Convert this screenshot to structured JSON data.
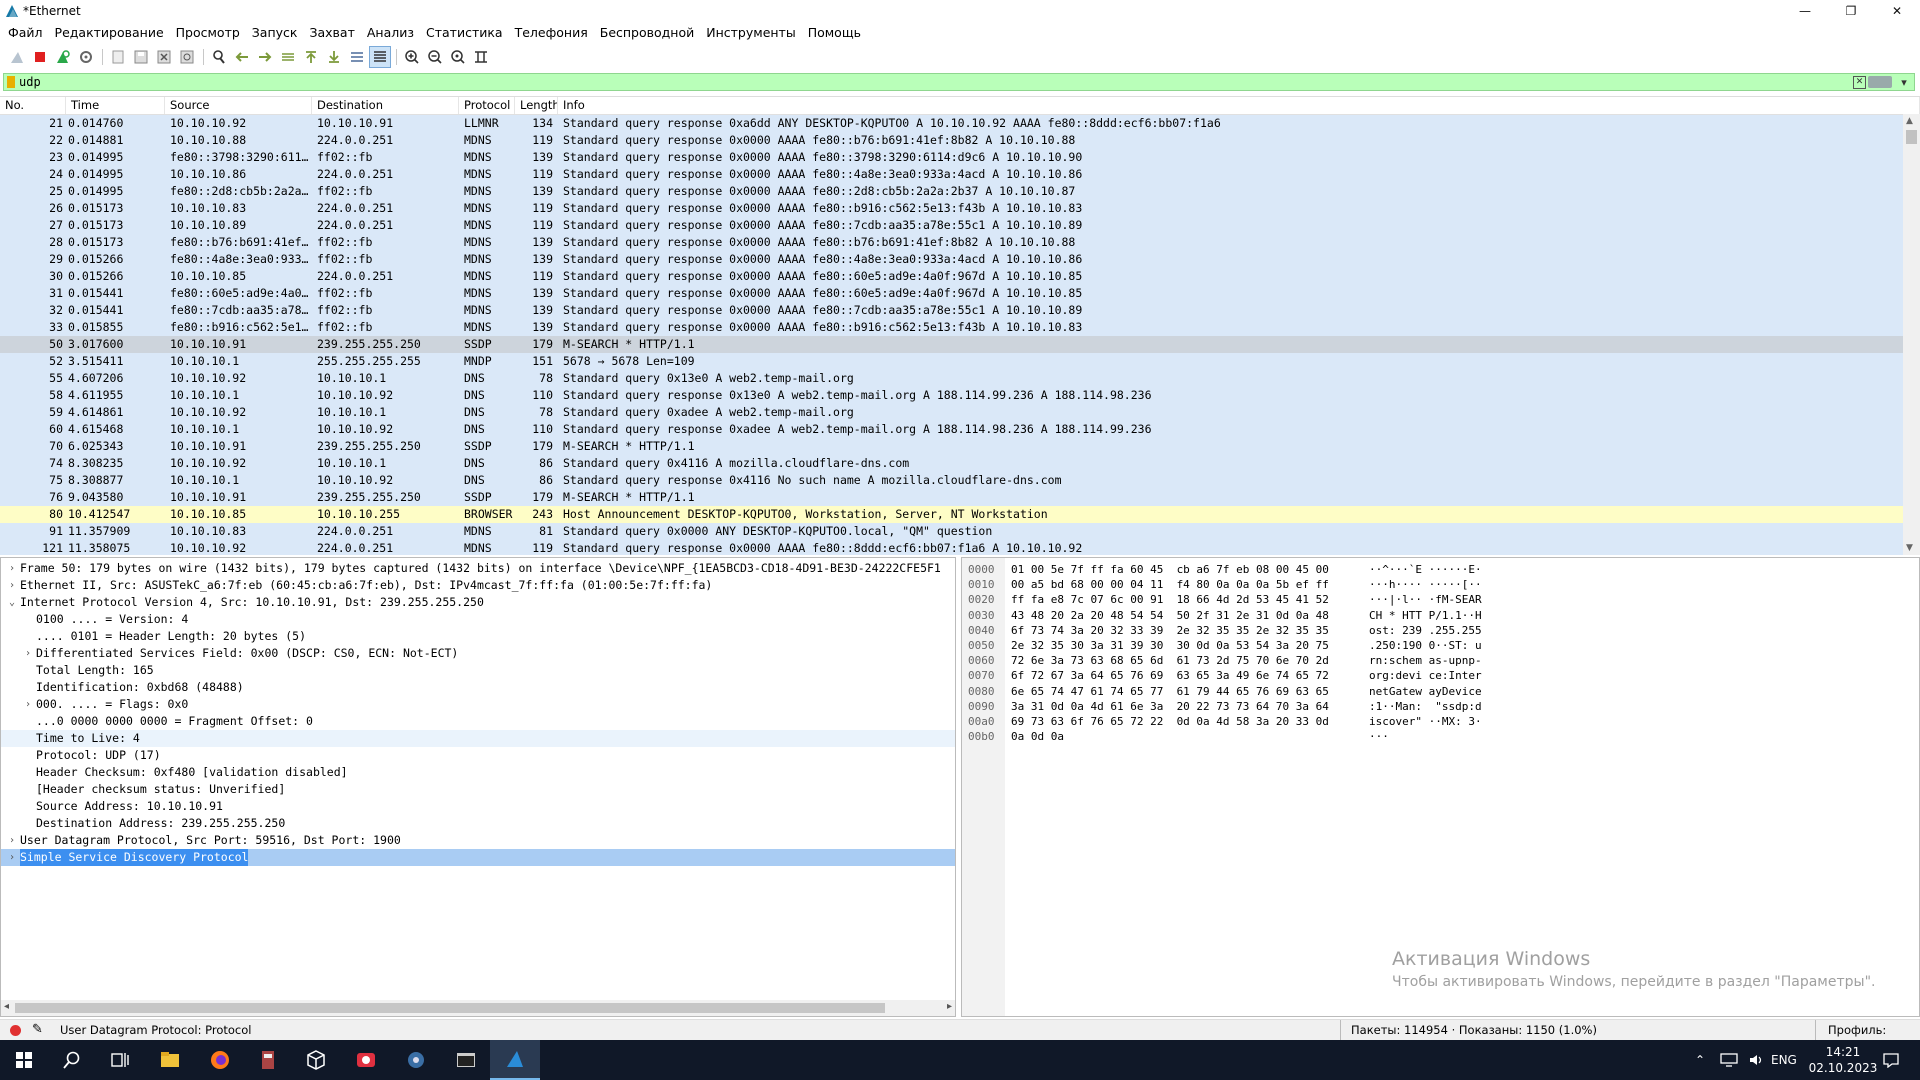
{
  "window": {
    "title": "*Ethernet",
    "controls": [
      "—",
      "❐",
      "✕"
    ]
  },
  "menu": [
    "Файл",
    "Редактирование",
    "Просмотр",
    "Запуск",
    "Захват",
    "Анализ",
    "Статистика",
    "Телефония",
    "Беспроводной",
    "Инструменты",
    "Помощь"
  ],
  "toolbar_icons": [
    "shark-fin-start-icon",
    "stop-icon",
    "restart-icon",
    "options-gear-icon",
    "open-file-icon",
    "save-icon",
    "close-file-icon",
    "reload-icon",
    "find-icon",
    "go-back-icon",
    "go-forward-icon",
    "go-to-packet-icon",
    "first-packet-icon",
    "last-packet-icon",
    "auto-scroll-icon",
    "colorize-icon",
    "zoom-in-icon",
    "zoom-out-icon",
    "normal-size-icon",
    "resize-columns-icon"
  ],
  "filter": {
    "value": "udp"
  },
  "packet_list": {
    "columns": [
      "No.",
      "Time",
      "Source",
      "Destination",
      "Protocol",
      "Length",
      "Info"
    ],
    "rows": [
      {
        "no": "21",
        "time": "0.014760",
        "src": "10.10.10.92",
        "dst": "10.10.10.91",
        "proto": "LLMNR",
        "len": "134",
        "info": "Standard query response 0xa6dd ANY DESKTOP-KQPUTO0 A 10.10.10.92 AAAA fe80::8ddd:ecf6:bb07:f1a6"
      },
      {
        "no": "22",
        "time": "0.014881",
        "src": "10.10.10.88",
        "dst": "224.0.0.251",
        "proto": "MDNS",
        "len": "119",
        "info": "Standard query response 0x0000 AAAA fe80::b76:b691:41ef:8b82 A 10.10.10.88"
      },
      {
        "no": "23",
        "time": "0.014995",
        "src": "fe80::3798:3290:611…",
        "dst": "ff02::fb",
        "proto": "MDNS",
        "len": "139",
        "info": "Standard query response 0x0000 AAAA fe80::3798:3290:6114:d9c6 A 10.10.10.90"
      },
      {
        "no": "24",
        "time": "0.014995",
        "src": "10.10.10.86",
        "dst": "224.0.0.251",
        "proto": "MDNS",
        "len": "119",
        "info": "Standard query response 0x0000 AAAA fe80::4a8e:3ea0:933a:4acd A 10.10.10.86"
      },
      {
        "no": "25",
        "time": "0.014995",
        "src": "fe80::2d8:cb5b:2a2a…",
        "dst": "ff02::fb",
        "proto": "MDNS",
        "len": "139",
        "info": "Standard query response 0x0000 AAAA fe80::2d8:cb5b:2a2a:2b37 A 10.10.10.87"
      },
      {
        "no": "26",
        "time": "0.015173",
        "src": "10.10.10.83",
        "dst": "224.0.0.251",
        "proto": "MDNS",
        "len": "119",
        "info": "Standard query response 0x0000 AAAA fe80::b916:c562:5e13:f43b A 10.10.10.83"
      },
      {
        "no": "27",
        "time": "0.015173",
        "src": "10.10.10.89",
        "dst": "224.0.0.251",
        "proto": "MDNS",
        "len": "119",
        "info": "Standard query response 0x0000 AAAA fe80::7cdb:aa35:a78e:55c1 A 10.10.10.89"
      },
      {
        "no": "28",
        "time": "0.015173",
        "src": "fe80::b76:b691:41ef…",
        "dst": "ff02::fb",
        "proto": "MDNS",
        "len": "139",
        "info": "Standard query response 0x0000 AAAA fe80::b76:b691:41ef:8b82 A 10.10.10.88"
      },
      {
        "no": "29",
        "time": "0.015266",
        "src": "fe80::4a8e:3ea0:933…",
        "dst": "ff02::fb",
        "proto": "MDNS",
        "len": "139",
        "info": "Standard query response 0x0000 AAAA fe80::4a8e:3ea0:933a:4acd A 10.10.10.86"
      },
      {
        "no": "30",
        "time": "0.015266",
        "src": "10.10.10.85",
        "dst": "224.0.0.251",
        "proto": "MDNS",
        "len": "119",
        "info": "Standard query response 0x0000 AAAA fe80::60e5:ad9e:4a0f:967d A 10.10.10.85"
      },
      {
        "no": "31",
        "time": "0.015441",
        "src": "fe80::60e5:ad9e:4a0…",
        "dst": "ff02::fb",
        "proto": "MDNS",
        "len": "139",
        "info": "Standard query response 0x0000 AAAA fe80::60e5:ad9e:4a0f:967d A 10.10.10.85"
      },
      {
        "no": "32",
        "time": "0.015441",
        "src": "fe80::7cdb:aa35:a78…",
        "dst": "ff02::fb",
        "proto": "MDNS",
        "len": "139",
        "info": "Standard query response 0x0000 AAAA fe80::7cdb:aa35:a78e:55c1 A 10.10.10.89"
      },
      {
        "no": "33",
        "time": "0.015855",
        "src": "fe80::b916:c562:5e1…",
        "dst": "ff02::fb",
        "proto": "MDNS",
        "len": "139",
        "info": "Standard query response 0x0000 AAAA fe80::b916:c562:5e13:f43b A 10.10.10.83"
      },
      {
        "no": "50",
        "time": "3.017600",
        "src": "10.10.10.91",
        "dst": "239.255.255.250",
        "proto": "SSDP",
        "len": "179",
        "info": "M-SEARCH * HTTP/1.1",
        "sel": true
      },
      {
        "no": "52",
        "time": "3.515411",
        "src": "10.10.10.1",
        "dst": "255.255.255.255",
        "proto": "MNDP",
        "len": "151",
        "info": "5678 → 5678 Len=109"
      },
      {
        "no": "55",
        "time": "4.607206",
        "src": "10.10.10.92",
        "dst": "10.10.10.1",
        "proto": "DNS",
        "len": "78",
        "info": "Standard query 0x13e0 A web2.temp-mail.org"
      },
      {
        "no": "58",
        "time": "4.611955",
        "src": "10.10.10.1",
        "dst": "10.10.10.92",
        "proto": "DNS",
        "len": "110",
        "info": "Standard query response 0x13e0 A web2.temp-mail.org A 188.114.99.236 A 188.114.98.236"
      },
      {
        "no": "59",
        "time": "4.614861",
        "src": "10.10.10.92",
        "dst": "10.10.10.1",
        "proto": "DNS",
        "len": "78",
        "info": "Standard query 0xadee A web2.temp-mail.org"
      },
      {
        "no": "60",
        "time": "4.615468",
        "src": "10.10.10.1",
        "dst": "10.10.10.92",
        "proto": "DNS",
        "len": "110",
        "info": "Standard query response 0xadee A web2.temp-mail.org A 188.114.98.236 A 188.114.99.236"
      },
      {
        "no": "70",
        "time": "6.025343",
        "src": "10.10.10.91",
        "dst": "239.255.255.250",
        "proto": "SSDP",
        "len": "179",
        "info": "M-SEARCH * HTTP/1.1"
      },
      {
        "no": "74",
        "time": "8.308235",
        "src": "10.10.10.92",
        "dst": "10.10.10.1",
        "proto": "DNS",
        "len": "86",
        "info": "Standard query 0x4116 A mozilla.cloudflare-dns.com"
      },
      {
        "no": "75",
        "time": "8.308877",
        "src": "10.10.10.1",
        "dst": "10.10.10.92",
        "proto": "DNS",
        "len": "86",
        "info": "Standard query response 0x4116 No such name A mozilla.cloudflare-dns.com"
      },
      {
        "no": "76",
        "time": "9.043580",
        "src": "10.10.10.91",
        "dst": "239.255.255.250",
        "proto": "SSDP",
        "len": "179",
        "info": "M-SEARCH * HTTP/1.1"
      },
      {
        "no": "80",
        "time": "10.412547",
        "src": "10.10.10.85",
        "dst": "10.10.10.255",
        "proto": "BROWSER",
        "len": "243",
        "info": "Host Announcement DESKTOP-KQPUTO0, Workstation, Server, NT Workstation",
        "browser": true
      },
      {
        "no": "91",
        "time": "11.357909",
        "src": "10.10.10.83",
        "dst": "224.0.0.251",
        "proto": "MDNS",
        "len": "81",
        "info": "Standard query 0x0000 ANY DESKTOP-KQPUTO0.local, \"QM\" question"
      },
      {
        "no": "121",
        "time": "11.358075",
        "src": "10.10.10.92",
        "dst": "224.0.0.251",
        "proto": "MDNS",
        "len": "119",
        "info": "Standard query response 0x0000 AAAA fe80::8ddd:ecf6:bb07:f1a6 A 10.10.10.92"
      }
    ]
  },
  "details": [
    {
      "indent": 0,
      "exp": "›",
      "text": "Frame 50: 179 bytes on wire (1432 bits), 179 bytes captured (1432 bits) on interface \\Device\\NPF_{1EA5BCD3-CD18-4D91-BE3D-24222CFE5F1"
    },
    {
      "indent": 0,
      "exp": "›",
      "text": "Ethernet II, Src: ASUSTekC_a6:7f:eb (60:45:cb:a6:7f:eb), Dst: IPv4mcast_7f:ff:fa (01:00:5e:7f:ff:fa)"
    },
    {
      "indent": 0,
      "exp": "⌄",
      "text": "Internet Protocol Version 4, Src: 10.10.10.91, Dst: 239.255.255.250"
    },
    {
      "indent": 1,
      "exp": "",
      "text": "0100 .... = Version: 4"
    },
    {
      "indent": 1,
      "exp": "",
      "text": ".... 0101 = Header Length: 20 bytes (5)"
    },
    {
      "indent": 1,
      "exp": "›",
      "text": "Differentiated Services Field: 0x00 (DSCP: CS0, ECN: Not-ECT)"
    },
    {
      "indent": 1,
      "exp": "",
      "text": "Total Length: 165"
    },
    {
      "indent": 1,
      "exp": "",
      "text": "Identification: 0xbd68 (48488)"
    },
    {
      "indent": 1,
      "exp": "›",
      "text": "000. .... = Flags: 0x0"
    },
    {
      "indent": 1,
      "exp": "",
      "text": "...0 0000 0000 0000 = Fragment Offset: 0"
    },
    {
      "indent": 1,
      "exp": "",
      "text": "Time to Live: 4",
      "hl": true
    },
    {
      "indent": 1,
      "exp": "",
      "text": "Protocol: UDP (17)"
    },
    {
      "indent": 1,
      "exp": "",
      "text": "Header Checksum: 0xf480 [validation disabled]"
    },
    {
      "indent": 1,
      "exp": "",
      "text": "[Header checksum status: Unverified]"
    },
    {
      "indent": 1,
      "exp": "",
      "text": "Source Address: 10.10.10.91"
    },
    {
      "indent": 1,
      "exp": "",
      "text": "Destination Address: 239.255.255.250"
    },
    {
      "indent": 0,
      "exp": "›",
      "text": "User Datagram Protocol, Src Port: 59516, Dst Port: 1900"
    },
    {
      "indent": 0,
      "exp": "›",
      "text": "Simple Service Discovery Protocol",
      "sel": true
    }
  ],
  "bytes": [
    {
      "off": "0000",
      "hex": "01 00 5e 7f ff fa 60 45  cb a6 7f eb 08 00 45 00",
      "ascii": "··^···`E ······E·"
    },
    {
      "off": "0010",
      "hex": "00 a5 bd 68 00 00 04 11  f4 80 0a 0a 0a 5b ef ff",
      "ascii": "···h···· ·····[··"
    },
    {
      "off": "0020",
      "hex": "ff fa e8 7c 07 6c 00 91  18 66 4d 2d 53 45 41 52",
      "ascii": "···|·l·· ·fM-SEAR"
    },
    {
      "off": "0030",
      "hex": "43 48 20 2a 20 48 54 54  50 2f 31 2e 31 0d 0a 48",
      "ascii": "CH * HTT P/1.1··H"
    },
    {
      "off": "0040",
      "hex": "6f 73 74 3a 20 32 33 39  2e 32 35 35 2e 32 35 35",
      "ascii": "ost: 239 .255.255"
    },
    {
      "off": "0050",
      "hex": "2e 32 35 30 3a 31 39 30  30 0d 0a 53 54 3a 20 75",
      "ascii": ".250:190 0··ST: u"
    },
    {
      "off": "0060",
      "hex": "72 6e 3a 73 63 68 65 6d  61 73 2d 75 70 6e 70 2d",
      "ascii": "rn:schem as-upnp-"
    },
    {
      "off": "0070",
      "hex": "6f 72 67 3a 64 65 76 69  63 65 3a 49 6e 74 65 72",
      "ascii": "org:devi ce:Inter"
    },
    {
      "off": "0080",
      "hex": "6e 65 74 47 61 74 65 77  61 79 44 65 76 69 63 65",
      "ascii": "netGatew ayDevice"
    },
    {
      "off": "0090",
      "hex": "3a 31 0d 0a 4d 61 6e 3a  20 22 73 73 64 70 3a 64",
      "ascii": ":1··Man:  \"ssdp:d"
    },
    {
      "off": "00a0",
      "hex": "69 73 63 6f 76 65 72 22  0d 0a 4d 58 3a 20 33 0d",
      "ascii": "iscover\" ··MX: 3·"
    },
    {
      "off": "00b0",
      "hex": "0a 0d 0a",
      "ascii": "···"
    }
  ],
  "watermark": {
    "title": "Активация Windows",
    "text": "Чтобы активировать Windows, перейдите в раздел \"Параметры\"."
  },
  "status": {
    "field": "User Datagram Protocol: Protocol",
    "packets": "Пакеты: 114954 · Показаны: 1150 (1.0%)",
    "profile": "Профиль: Default"
  },
  "taskbar": {
    "apps": [
      "start-icon",
      "search-icon",
      "task-view-icon",
      "file-explorer-icon",
      "firefox-icon",
      "archive-app-icon",
      "3d-box-app-icon",
      "screen-recorder-icon",
      "settings-app-icon",
      "terminal-app-icon",
      "wireshark-icon"
    ],
    "lang": "ENG",
    "time": "14:21",
    "date": "02.10.2023"
  },
  "colors": {
    "row_bg": "#dae8f8",
    "row_selected": "#cdd4dc",
    "row_browser": "#fefdc6",
    "filter_valid": "#b9ffb9",
    "tree_selected": "#3c8ff0",
    "taskbar": "#101828"
  }
}
